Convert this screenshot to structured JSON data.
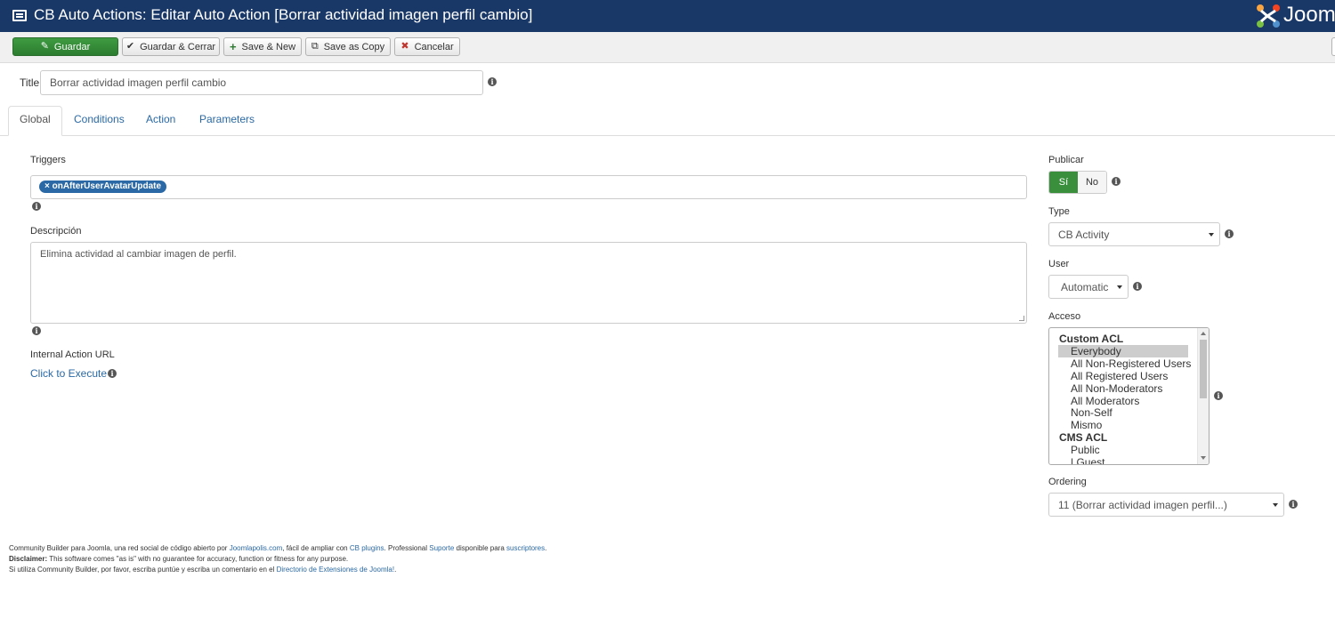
{
  "header": {
    "title": "CB Auto Actions: Editar Auto Action [Borrar actividad imagen perfil cambio]",
    "logo_text": "Joom",
    "icon": "list-icon",
    "bg_color": "#1a3867"
  },
  "toolbar": {
    "save_label": "Guardar",
    "save_close_label": "Guardar & Cerrar",
    "save_new_label": "Save & New",
    "save_copy_label": "Save as Copy",
    "cancel_label": "Cancelar"
  },
  "title_field": {
    "label": "Title",
    "value": "Borrar actividad imagen perfil cambio"
  },
  "tabs": [
    {
      "label": "Global",
      "active": true
    },
    {
      "label": "Conditions",
      "active": false
    },
    {
      "label": "Action",
      "active": false
    },
    {
      "label": "Parameters",
      "active": false
    }
  ],
  "global": {
    "triggers_label": "Triggers",
    "trigger_tag": "× onAfterUserAvatarUpdate",
    "description_label": "Descripción",
    "description_value": "Elimina actividad al cambiar imagen de perfil.",
    "internal_url_label": "Internal Action URL",
    "execute_link": "Click to Execute"
  },
  "right": {
    "publish_label": "Publicar",
    "publish_yes": "Sí",
    "publish_no": "No",
    "type_label": "Type",
    "type_value": "CB Activity",
    "user_label": "User",
    "user_value": "Automatic",
    "access_label": "Acceso",
    "access_groups": [
      {
        "name": "Custom ACL",
        "options": [
          "Everybody",
          "All Non-Registered Users",
          "All Registered Users",
          "All Non-Moderators",
          "All Moderators",
          "Non-Self",
          "Mismo"
        ]
      },
      {
        "name": "CMS ACL",
        "options": [
          "Public",
          "| Guest"
        ]
      }
    ],
    "access_selected": "Everybody",
    "ordering_label": "Ordering",
    "ordering_value": "11 (Borrar actividad imagen perfil...)"
  },
  "footer": {
    "line1_a": "Community Builder para Joomla, una red social de código abierto por ",
    "line1_link1": "Joomlapolis.com",
    "line1_b": ", fácil de ampliar con ",
    "line1_link2": "CB plugins",
    "line1_c": ". Professional ",
    "line1_link3": "Suporte",
    "line1_d": " disponible para ",
    "line1_link4": "suscriptores",
    "line1_e": ".",
    "line2_bold": "Disclaimer:",
    "line2_rest": " This software comes \"as is\" with no guarantee for accuracy, function or fitness for any purpose.",
    "line3_a": "Si utiliza Community Builder, por favor, escriba puntúe y escriba un comentario en el ",
    "line3_link": "Directorio de Extensiones de Joomla!",
    "line3_b": "."
  }
}
